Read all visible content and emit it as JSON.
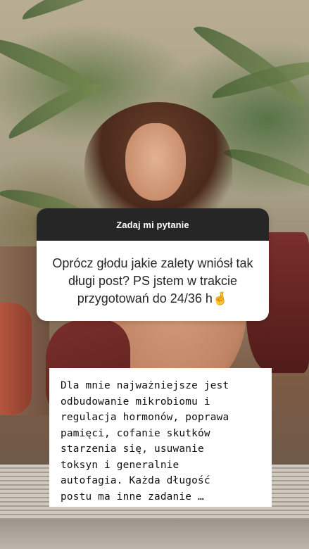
{
  "story": {
    "question_sticker": {
      "header": "Zadaj mi pytanie",
      "question": "Oprócz głodu jakie zalety wniósł tak długi post? PS jstem w trakcie przygotowań do 24/36 h🤞"
    },
    "answer": {
      "text": "Dla mnie najważniejsze jest\nodbudowanie mikrobiomu i\nregulacja hormonów, poprawa\npamięci, cofanie skutków\nstarzenia się, usuwanie\ntoksyn i generalnie\nautofagia.  Każda długość\npostu ma inne zadanie …"
    }
  }
}
